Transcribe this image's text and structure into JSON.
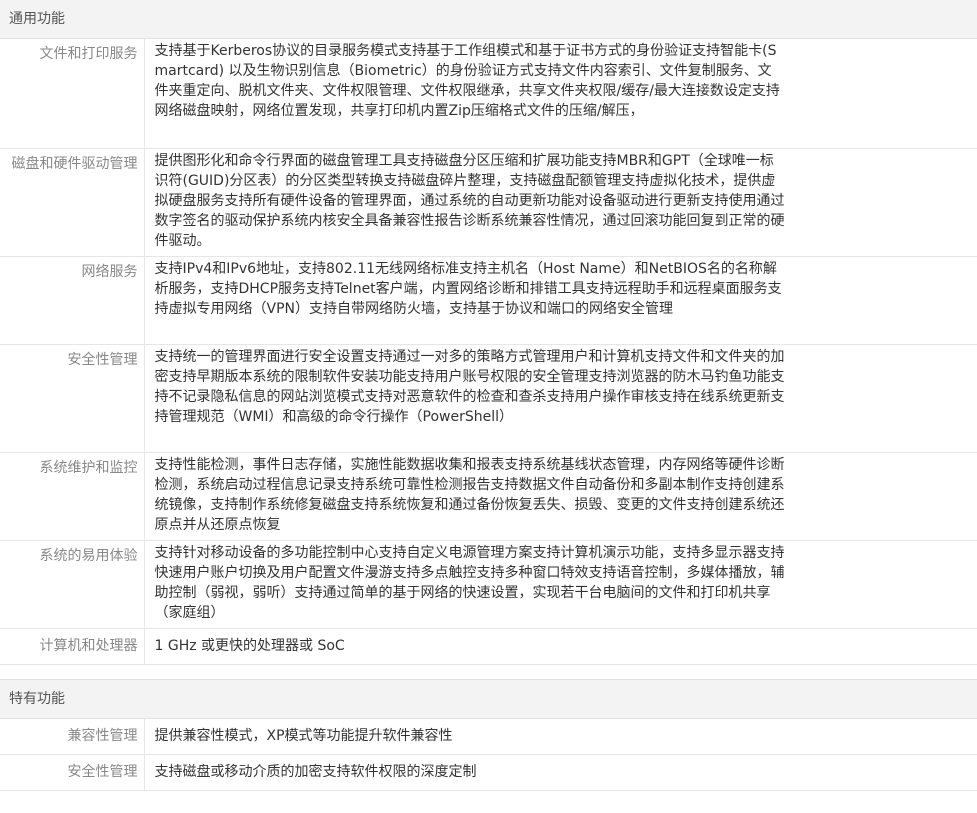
{
  "sections": [
    {
      "title": "通用功能",
      "rows": [
        {
          "label": "文件和打印服务",
          "value": "支持基于Kerberos协议的目录服务模式支持基于工作组模式和基于证书方式的身份验证支持智能卡(Smartcard) 以及生物识别信息（Biometric）的身份验证方式支持文件内容索引、文件复制服务、文件夹重定向、脱机文件夹、文件权限管理、文件权限继承，共享文件夹权限/缓存/最大连接数设定支持网络磁盘映射，网络位置发现，共享打印机内置Zip压缩格式文件的压缩/解压，"
        },
        {
          "label": "磁盘和硬件驱动管理",
          "value": "提供图形化和命令行界面的磁盘管理工具支持磁盘分区压缩和扩展功能支持MBR和GPT（全球唯一标识符(GUID)分区表）的分区类型转换支持磁盘碎片整理，支持磁盘配额管理支持虚拟化技术，提供虚拟硬盘服务支持所有硬件设备的管理界面，通过系统的自动更新功能对设备驱动进行更新支持使用通过数字签名的驱动保护系统内核安全具备兼容性报告诊断系统兼容性情况，通过回滚功能回复到正常的硬件驱动。"
        },
        {
          "label": "网络服务",
          "value": "支持IPv4和IPv6地址，支持802.11无线网络标准支持主机名（Host Name）和NetBIOS名的名称解析服务，支持DHCP服务支持Telnet客户端，内置网络诊断和排错工具支持远程助手和远程桌面服务支持虚拟专用网络（VPN）支持自带网络防火墙，支持基于协议和端口的网络安全管理"
        },
        {
          "label": "安全性管理",
          "value": "支持统一的管理界面进行安全设置支持通过一对多的策略方式管理用户和计算机支持文件和文件夹的加密支持早期版本系统的限制软件安装功能支持用户账号权限的安全管理支持浏览器的防木马钓鱼功能支持不记录隐私信息的网站浏览模式支持对恶意软件的检查和查杀支持用户操作审核支持在线系统更新支持管理规范（WMI）和高级的命令行操作（PowerShell）"
        },
        {
          "label": "系统维护和监控",
          "value": "支持性能检测，事件日志存储，实施性能数据收集和报表支持系统基线状态管理，内存网络等硬件诊断检测，系统启动过程信息记录支持系统可靠性检测报告支持数据文件自动备份和多副本制作支持创建系统镜像，支持制作系统修复磁盘支持系统恢复和通过备份恢复丢失、损毁、变更的文件支持创建系统还原点并从还原点恢复"
        },
        {
          "label": "系统的易用体验",
          "value": "支持针对移动设备的多功能控制中心支持自定义电源管理方案支持计算机演示功能，支持多显示器支持快速用户账户切换及用户配置文件漫游支持多点触控支持多种窗口特效支持语音控制，多媒体播放，辅助控制（弱视，弱听）支持通过简单的基于网络的快速设置，实现若干台电脑间的文件和打印机共享（家庭组）"
        },
        {
          "label": "计算机和处理器",
          "value": "1 GHz 或更快的处理器或 SoC"
        }
      ]
    },
    {
      "title": "特有功能",
      "rows": [
        {
          "label": "兼容性管理",
          "value": "提供兼容性模式，XP模式等功能提升软件兼容性"
        },
        {
          "label": "安全性管理",
          "value": "支持磁盘或移动介质的加密支持软件权限的深度定制"
        }
      ]
    }
  ]
}
